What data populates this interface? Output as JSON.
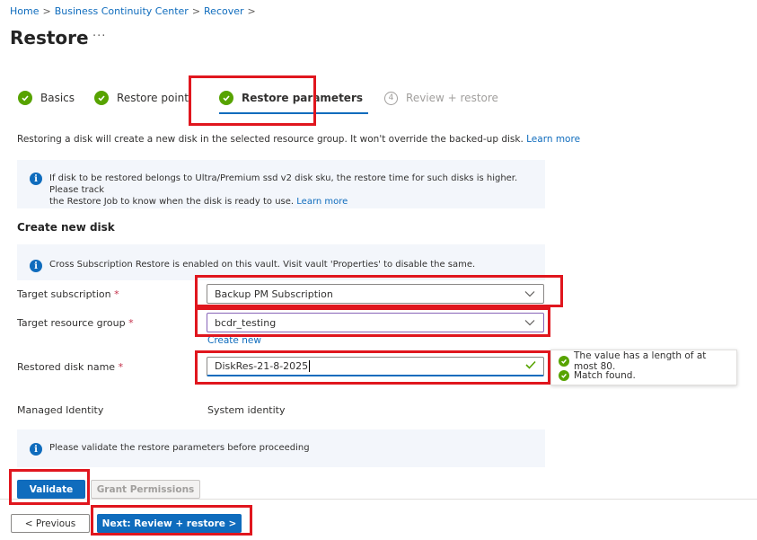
{
  "breadcrumb": {
    "items": [
      "Home",
      "Business Continuity Center",
      "Recover"
    ],
    "separator": ">"
  },
  "page": {
    "title": "Restore",
    "more": "···"
  },
  "steps": [
    {
      "label": "Basics",
      "state": "complete"
    },
    {
      "label": "Restore point",
      "state": "complete"
    },
    {
      "label": "Restore parameters",
      "state": "active"
    },
    {
      "label": "Review + restore",
      "state": "disabled",
      "number": "4"
    }
  ],
  "intro": {
    "text": "Restoring a disk will create a new disk in the selected resource group. It won't override the backed-up disk.",
    "link": "Learn more"
  },
  "notice_ultra": {
    "line1": "If disk to be restored belongs to Ultra/Premium ssd v2 disk sku, the restore time for such disks is higher. Please track",
    "line2": "the Restore Job to know when the disk is ready to use.",
    "link": "Learn more"
  },
  "section": {
    "title": "Create new disk"
  },
  "notice_csr": {
    "text": "Cross Subscription Restore is enabled on this vault. Visit vault 'Properties' to disable the same."
  },
  "form": {
    "target_subscription": {
      "label": "Target subscription",
      "required": "*",
      "value": "Backup PM Subscription"
    },
    "target_resource_group": {
      "label": "Target resource group",
      "required": "*",
      "value": "bcdr_testing",
      "create_new": "Create new"
    },
    "restored_disk_name": {
      "label": "Restored disk name",
      "required": "*",
      "value": "DiskRes-21-8-2025"
    },
    "managed_identity": {
      "label": "Managed Identity",
      "value": "System identity"
    }
  },
  "validation_tooltip": {
    "rule1": "The value has a length of at most 80.",
    "rule2": "Match found."
  },
  "notice_validate": {
    "text": "Please validate the restore parameters before proceeding"
  },
  "buttons": {
    "validate": "Validate",
    "grant_permissions": "Grant Permissions",
    "previous": "< Previous",
    "next": "Next: Review + restore >"
  },
  "colors": {
    "accent": "#0f6cbd",
    "success": "#57a300",
    "highlight": "#e0161e",
    "info_bg": "#f3f6fb"
  }
}
